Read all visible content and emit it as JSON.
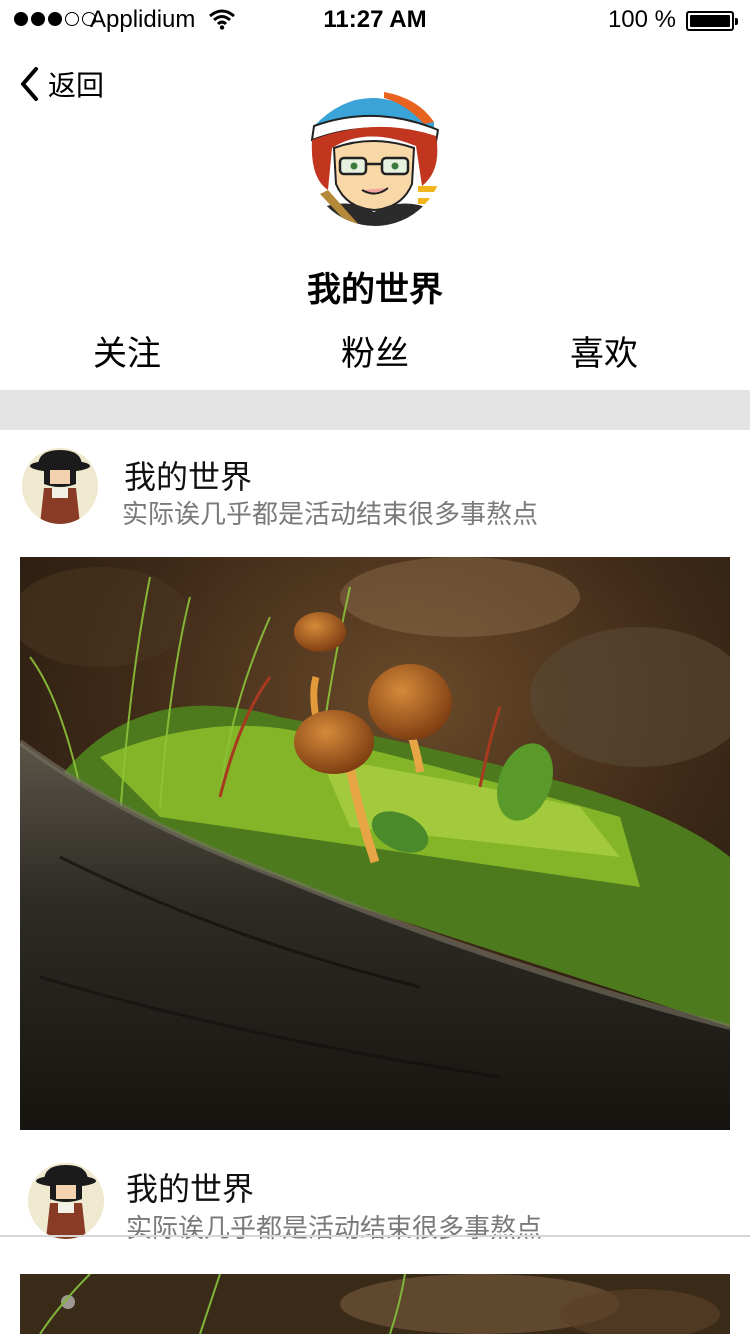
{
  "status_bar": {
    "carrier": "Applidium",
    "time": "11:27 AM",
    "battery": "100 %"
  },
  "nav": {
    "back_label": "返回"
  },
  "profile": {
    "name": "我的世界"
  },
  "stats": [
    {
      "label": "关注"
    },
    {
      "label": "粉丝"
    },
    {
      "label": "喜欢"
    }
  ],
  "posts": [
    {
      "title": "我的世界",
      "subtitle": "实际诶几乎都是活动结束很多事熬点"
    },
    {
      "title": "我的世界",
      "subtitle": "实际诶几乎都是活动结束很多事熬点"
    }
  ],
  "colors": {
    "divider_band": "#e3e3e3",
    "subtitle_gray": "#7a7a7a"
  }
}
